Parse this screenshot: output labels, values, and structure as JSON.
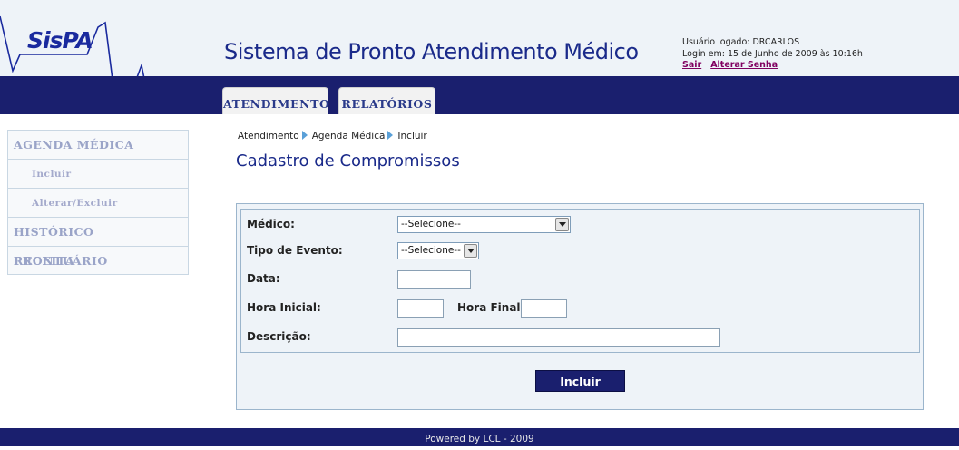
{
  "logo": {
    "text": "SisPA"
  },
  "header": {
    "title": "Sistema de Pronto Atendimento Médico",
    "user_line": "Usuário logado: DRCARLOS",
    "login_line": "Login em: 15 de Junho de 2009 às 10:16h",
    "logout_label": "Sair",
    "change_password_label": "Alterar Senha"
  },
  "tabs": [
    {
      "label": "ATENDIMENTO"
    },
    {
      "label": "RELATÓRIOS"
    }
  ],
  "sidebar": {
    "items": [
      {
        "label": "AGENDA MÉDICA"
      },
      {
        "label": "Incluir"
      },
      {
        "label": "Alterar/Excluir"
      },
      {
        "label": "HISTÓRICO PRONTUÁRIO"
      },
      {
        "label": "RECEITA"
      }
    ]
  },
  "breadcrumb": [
    "Atendimento",
    "Agenda Médica",
    "Incluir"
  ],
  "page_title": "Cadastro de Compromissos",
  "form": {
    "medico_label": "Médico:",
    "medico_value": "--Selecione--",
    "tipo_label": "Tipo de Evento:",
    "tipo_value": "--Selecione--",
    "data_label": "Data:",
    "data_value": "",
    "hora_inicial_label": "Hora Inicial:",
    "hora_inicial_value": "",
    "hora_final_label": "Hora Final:",
    "hora_final_value": "",
    "descricao_label": "Descrição:",
    "descricao_value": "",
    "submit_label": "Incluir"
  },
  "footer": {
    "text": "Powered by LCL - 2009"
  },
  "colors": {
    "navy": "#1a1f6e",
    "panel": "#eef3f8",
    "title_blue": "#1a2a8a"
  }
}
